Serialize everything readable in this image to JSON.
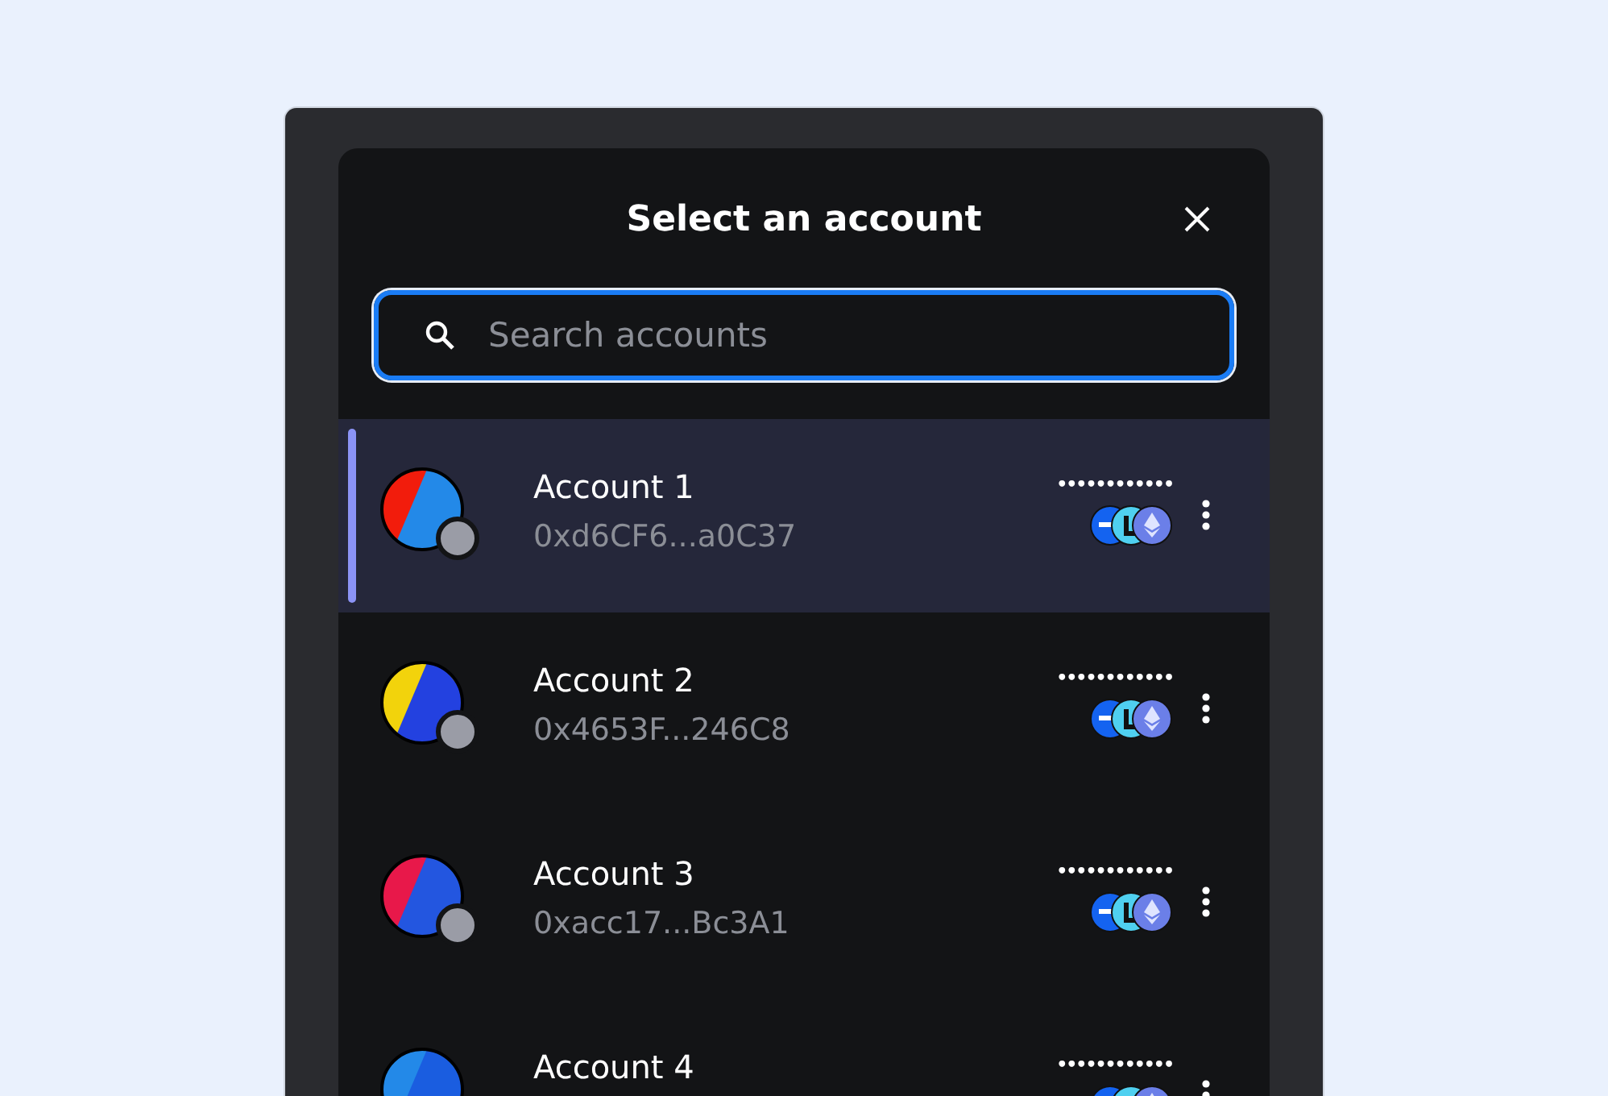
{
  "modal": {
    "title": "Select an account",
    "search": {
      "placeholder": "Search accounts"
    }
  },
  "accounts": [
    {
      "name": "Account 1",
      "address": "0xd6CF6...a0C37",
      "balance": "••••••••••••",
      "selected": true
    },
    {
      "name": "Account 2",
      "address": "0x4653F...246C8",
      "balance": "••••••••••••",
      "selected": false
    },
    {
      "name": "Account 3",
      "address": "0xacc17...Bc3A1",
      "balance": "••••••••••••",
      "selected": false
    },
    {
      "name": "Account 4",
      "balance": "••••••••••••",
      "selected": false
    }
  ]
}
